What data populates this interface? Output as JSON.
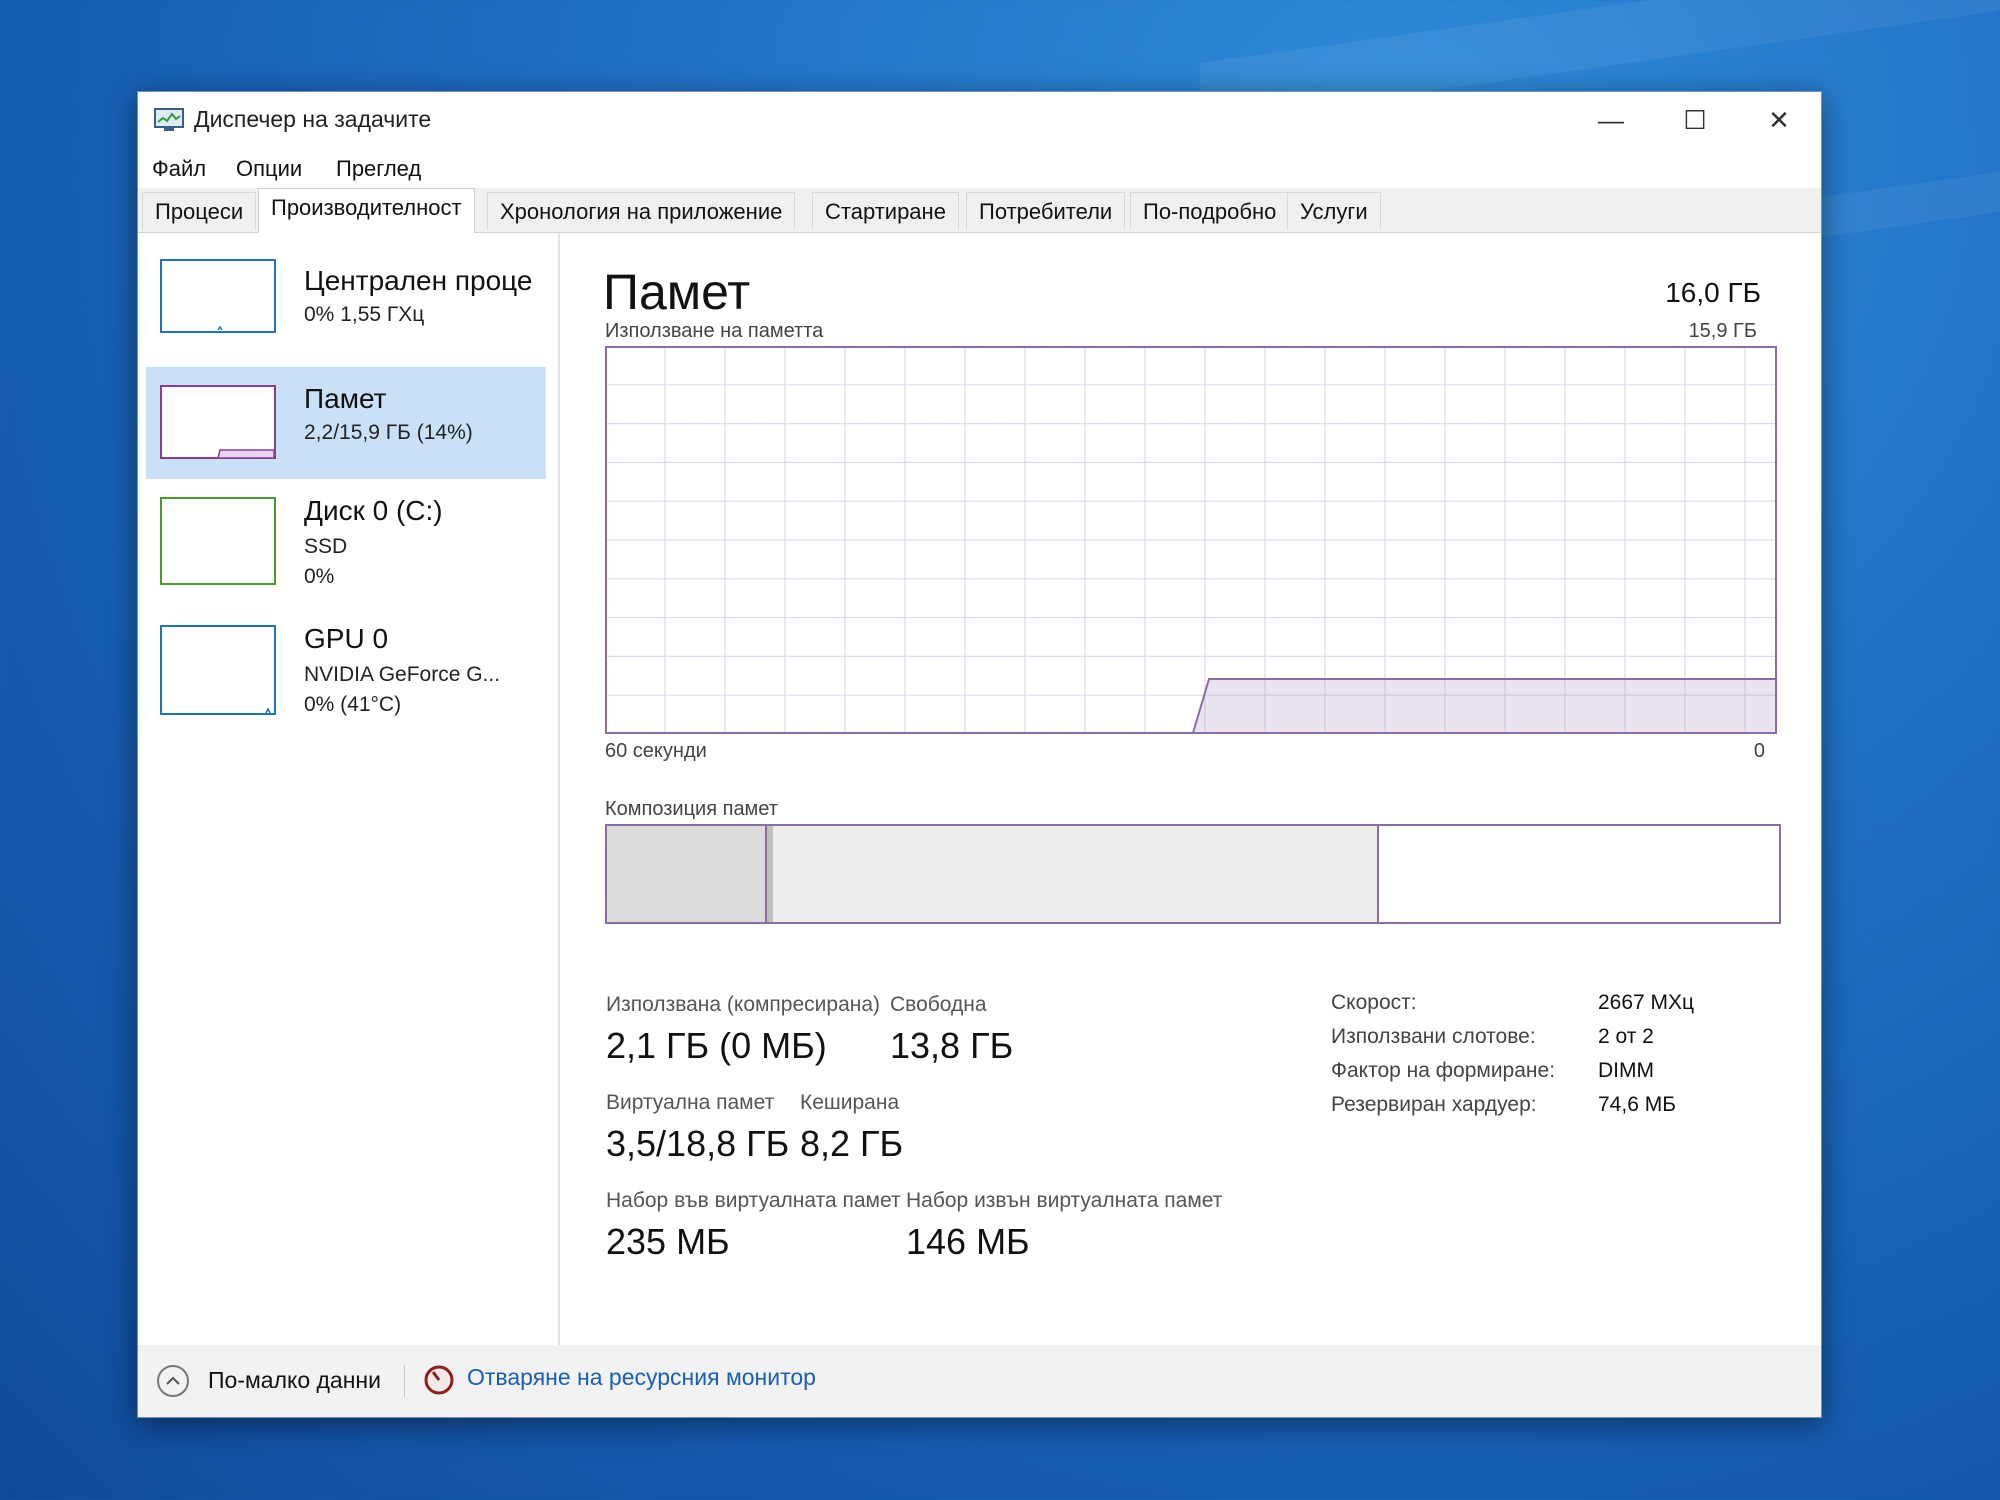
{
  "window": {
    "title": "Диспечер на задачите",
    "controls": {
      "minimize": "—",
      "maximize": "☐",
      "close": "✕"
    }
  },
  "menu": [
    "Файл",
    "Опции",
    "Преглед"
  ],
  "tabs": [
    "Процеси",
    "Производителност",
    "Хронология на приложение",
    "Стартиране",
    "Потребители",
    "По-подробно",
    "Услуги"
  ],
  "active_tab": "Производителност",
  "sidebar": {
    "items": [
      {
        "title": "Централен проце",
        "sub1": "0%  1,55 ГХц",
        "sub2": "",
        "color": "#1e73be"
      },
      {
        "title": "Памет",
        "sub1": "2,2/15,9 ГБ (14%)",
        "sub2": "",
        "color": "#8b3a9c"
      },
      {
        "title": "Диск 0 (C:)",
        "sub1": "SSD",
        "sub2": "0%",
        "color": "#4a9a2a"
      },
      {
        "title": "GPU 0",
        "sub1": "NVIDIA GeForce G...",
        "sub2": "0% (41°C)",
        "color": "#1e73be"
      }
    ],
    "selected_index": 1
  },
  "memory": {
    "title": "Памет",
    "total": "16,0 ГБ",
    "usage_label": "Използване на паметта",
    "usage_max": "15,9 ГБ",
    "time_left": "60 секунди",
    "time_right": "0",
    "composition_label": "Композиция памет",
    "accent": "#8b6ca3",
    "stats": {
      "used_label": "Използвана (компресирана)",
      "used_value": "2,1 ГБ (0 МБ)",
      "free_label": "Свободна",
      "free_value": "13,8 ГБ",
      "virtual_label": "Виртуална памет",
      "virtual_value": "3,5/18,8 ГБ",
      "cached_label": "Кеширана",
      "cached_value": "8,2 ГБ",
      "paged_label": "Набор във виртуалната памет",
      "paged_value": "235 МБ",
      "nonpaged_label": "Набор извън виртуалната памет",
      "nonpaged_value": "146 МБ"
    },
    "details": [
      {
        "key": "Скорост:",
        "value": "2667 МХц"
      },
      {
        "key": "Използвани слотове:",
        "value": "2 от 2"
      },
      {
        "key": "Фактор на формиране:",
        "value": "DIMM"
      },
      {
        "key": "Резервиран хардуер:",
        "value": "74,6 МБ"
      }
    ]
  },
  "footer": {
    "fewer_details": "По-малко данни",
    "resource_monitor": "Отваряне на ресурсния монитор"
  }
}
